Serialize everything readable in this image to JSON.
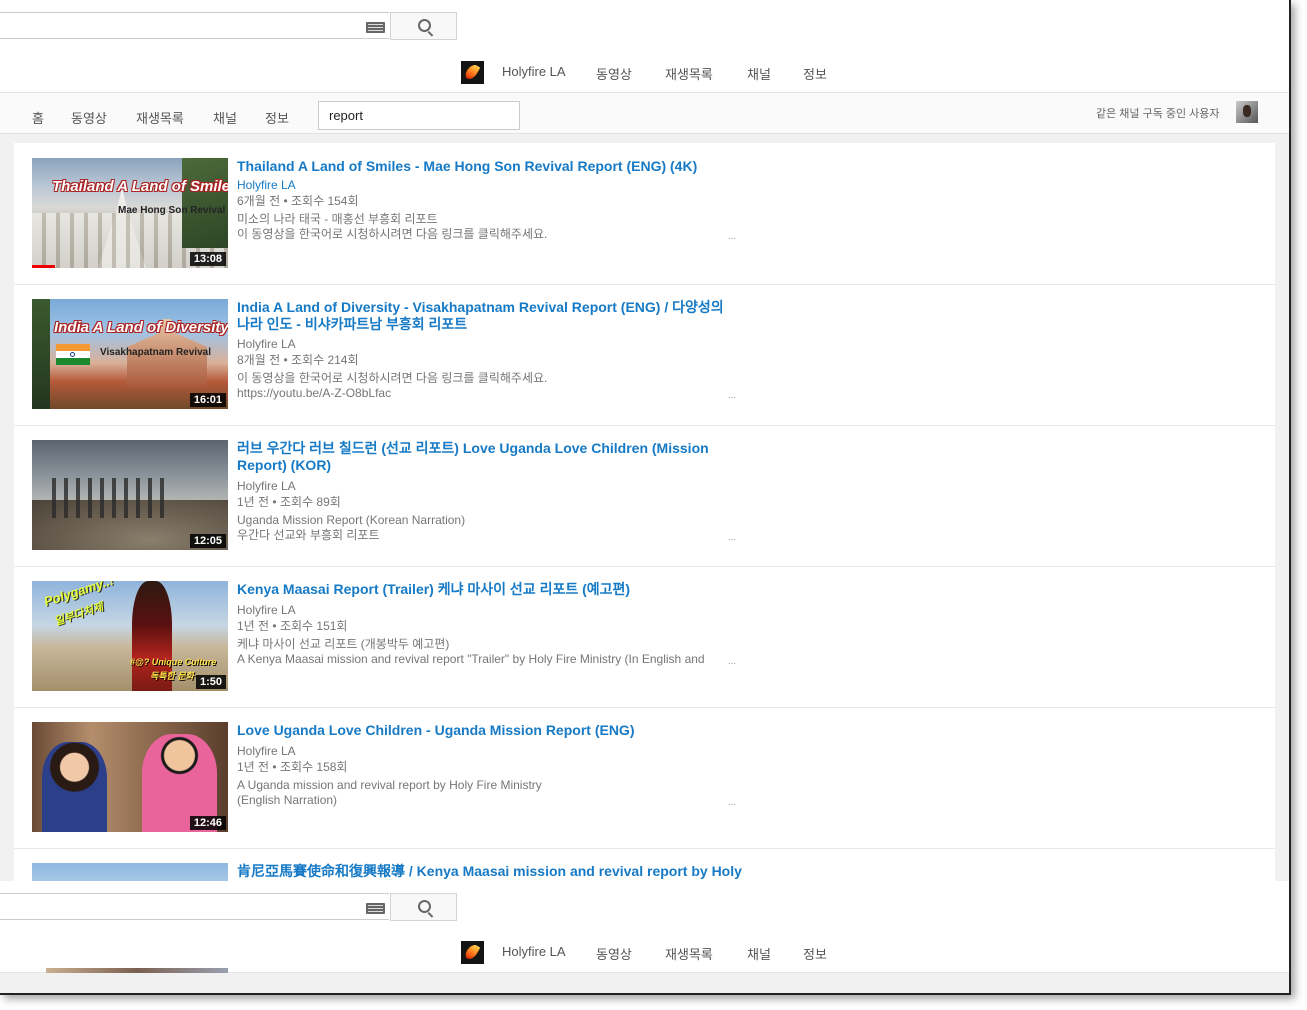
{
  "searchbar": {
    "placeholder": ""
  },
  "channel_nav": {
    "channel_name": "Holyfire LA",
    "links": [
      "동영상",
      "재생목록",
      "채널",
      "정보"
    ]
  },
  "tabs": {
    "items": [
      "홈",
      "동영상",
      "재생목록",
      "채널",
      "정보"
    ],
    "search_value": "report",
    "subscribers_label": "같은 채널 구독 중인 사용자"
  },
  "videos": [
    {
      "title": "Thailand A Land of Smiles - Mae Hong Son Revival Report (ENG) (4K)",
      "channel": "Holyfire LA",
      "meta": "6개월 전 • 조회수 154회",
      "desc": [
        "미소의 나라 태국 - 매홍선 부흥회 리포트",
        "이 동영상을 한국어로 시청하시려면 다음 링크를 클릭해주세요."
      ],
      "duration": "13:08",
      "thumb_text": [
        "Thailand A Land of Smiles",
        "Mae Hong Son Revival"
      ]
    },
    {
      "title": "India A Land of Diversity - Visakhapatnam Revival Report (ENG) / 다양성의 나라 인도 - 비샤카파트남 부흥회 리포트",
      "channel": "Holyfire LA",
      "meta": "8개월 전 • 조회수 214회",
      "desc": [
        "이 동영상을 한국어로 시청하시려면 다음 링크를 클릭해주세요.",
        "https://youtu.be/A-Z-O8bLfac"
      ],
      "duration": "16:01",
      "thumb_text": [
        "India A Land of Diversity",
        "Visakhapatnam Revival"
      ]
    },
    {
      "title": "러브 우간다 러브 칠드런 (선교 리포트) Love Uganda Love Children (Mission Report) (KOR)",
      "channel": "Holyfire LA",
      "meta": "1년 전 • 조회수 89회",
      "desc": [
        "Uganda Mission Report (Korean Narration)",
        "우간다 선교와 부흥회 리포트"
      ],
      "duration": "12:05",
      "thumb_text": []
    },
    {
      "title": "Kenya Maasai Report (Trailer) 케냐 마사이 선교 리포트 (예고편)",
      "channel": "Holyfire LA",
      "meta": "1년 전 • 조회수 151회",
      "desc": [
        "케냐 마사이 선교 리포트 (개봉박두 예고편)",
        "A Kenya Maasai mission and revival report \"Trailer\" by Holy Fire Ministry (In English and"
      ],
      "duration": "1:50",
      "thumb_text": [
        "Polygamy..!",
        "일부다처제",
        "#@? Unique Culture",
        "독특한 문화"
      ]
    },
    {
      "title": "Love Uganda Love Children - Uganda Mission Report (ENG)",
      "channel": "Holyfire LA",
      "meta": "1년 전 • 조회수 158회",
      "desc": [
        "A Uganda mission and revival report by Holy Fire Ministry",
        "(English Narration)"
      ],
      "duration": "12:46",
      "thumb_text": []
    },
    {
      "title": "肯尼亞馬賽使命和復興報導 / Kenya Maasai mission and revival report by Holy",
      "channel": "",
      "meta": "",
      "desc": [],
      "duration": "",
      "thumb_text": []
    }
  ],
  "more_symbol": "...",
  "colors": {
    "link_blue": "#167ac6",
    "meta_gray": "#767676",
    "progress_red": "#e00000"
  },
  "icons": [
    "keyboard-icon",
    "search-icon",
    "holyfire-logo-icon",
    "avatar"
  ]
}
